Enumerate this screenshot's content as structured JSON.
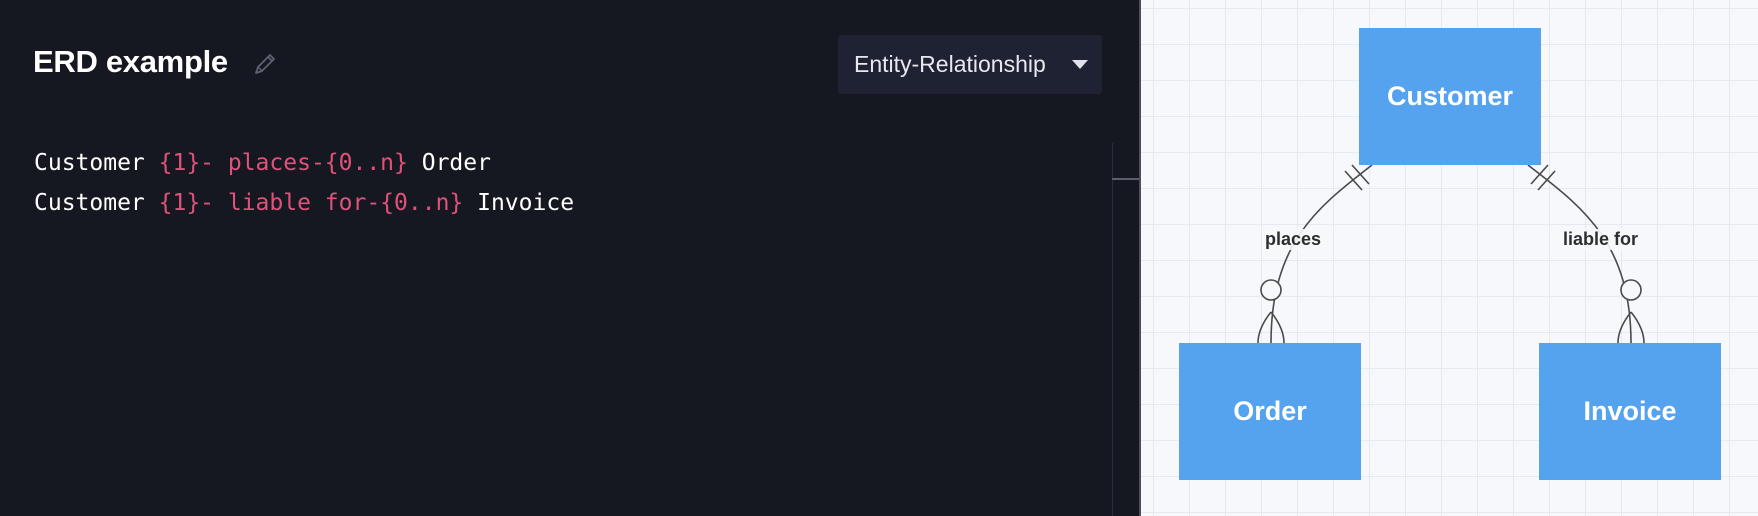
{
  "editor": {
    "title": "ERD example",
    "diagram_type": "Entity-Relationship",
    "lines": [
      {
        "left": "Customer ",
        "relation": "{1}- places-{0..n}",
        "right": " Order"
      },
      {
        "left": "Customer ",
        "relation": "{1}- liable for-{0..n}",
        "right": " Invoice"
      }
    ]
  },
  "diagram": {
    "entities": {
      "customer": "Customer",
      "order": "Order",
      "invoice": "Invoice"
    },
    "relations": {
      "places": "places",
      "liable_for": "liable for"
    }
  },
  "colors": {
    "editor_background": "#151821",
    "entity_fill": "#55a2ef",
    "relation_text": "#e0527a",
    "canvas_background": "#f6f8fc"
  }
}
